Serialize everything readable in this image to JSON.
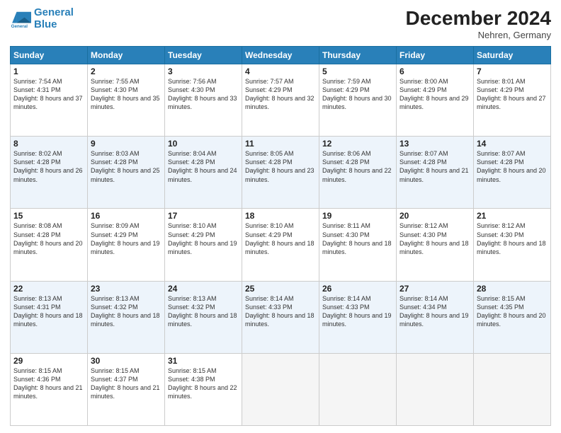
{
  "logo": {
    "line1": "General",
    "line2": "Blue"
  },
  "title": "December 2024",
  "subtitle": "Nehren, Germany",
  "days_header": [
    "Sunday",
    "Monday",
    "Tuesday",
    "Wednesday",
    "Thursday",
    "Friday",
    "Saturday"
  ],
  "weeks": [
    [
      {
        "day": "1",
        "sunrise": "Sunrise: 7:54 AM",
        "sunset": "Sunset: 4:31 PM",
        "daylight": "Daylight: 8 hours and 37 minutes."
      },
      {
        "day": "2",
        "sunrise": "Sunrise: 7:55 AM",
        "sunset": "Sunset: 4:30 PM",
        "daylight": "Daylight: 8 hours and 35 minutes."
      },
      {
        "day": "3",
        "sunrise": "Sunrise: 7:56 AM",
        "sunset": "Sunset: 4:30 PM",
        "daylight": "Daylight: 8 hours and 33 minutes."
      },
      {
        "day": "4",
        "sunrise": "Sunrise: 7:57 AM",
        "sunset": "Sunset: 4:29 PM",
        "daylight": "Daylight: 8 hours and 32 minutes."
      },
      {
        "day": "5",
        "sunrise": "Sunrise: 7:59 AM",
        "sunset": "Sunset: 4:29 PM",
        "daylight": "Daylight: 8 hours and 30 minutes."
      },
      {
        "day": "6",
        "sunrise": "Sunrise: 8:00 AM",
        "sunset": "Sunset: 4:29 PM",
        "daylight": "Daylight: 8 hours and 29 minutes."
      },
      {
        "day": "7",
        "sunrise": "Sunrise: 8:01 AM",
        "sunset": "Sunset: 4:29 PM",
        "daylight": "Daylight: 8 hours and 27 minutes."
      }
    ],
    [
      {
        "day": "8",
        "sunrise": "Sunrise: 8:02 AM",
        "sunset": "Sunset: 4:28 PM",
        "daylight": "Daylight: 8 hours and 26 minutes."
      },
      {
        "day": "9",
        "sunrise": "Sunrise: 8:03 AM",
        "sunset": "Sunset: 4:28 PM",
        "daylight": "Daylight: 8 hours and 25 minutes."
      },
      {
        "day": "10",
        "sunrise": "Sunrise: 8:04 AM",
        "sunset": "Sunset: 4:28 PM",
        "daylight": "Daylight: 8 hours and 24 minutes."
      },
      {
        "day": "11",
        "sunrise": "Sunrise: 8:05 AM",
        "sunset": "Sunset: 4:28 PM",
        "daylight": "Daylight: 8 hours and 23 minutes."
      },
      {
        "day": "12",
        "sunrise": "Sunrise: 8:06 AM",
        "sunset": "Sunset: 4:28 PM",
        "daylight": "Daylight: 8 hours and 22 minutes."
      },
      {
        "day": "13",
        "sunrise": "Sunrise: 8:07 AM",
        "sunset": "Sunset: 4:28 PM",
        "daylight": "Daylight: 8 hours and 21 minutes."
      },
      {
        "day": "14",
        "sunrise": "Sunrise: 8:07 AM",
        "sunset": "Sunset: 4:28 PM",
        "daylight": "Daylight: 8 hours and 20 minutes."
      }
    ],
    [
      {
        "day": "15",
        "sunrise": "Sunrise: 8:08 AM",
        "sunset": "Sunset: 4:28 PM",
        "daylight": "Daylight: 8 hours and 20 minutes."
      },
      {
        "day": "16",
        "sunrise": "Sunrise: 8:09 AM",
        "sunset": "Sunset: 4:29 PM",
        "daylight": "Daylight: 8 hours and 19 minutes."
      },
      {
        "day": "17",
        "sunrise": "Sunrise: 8:10 AM",
        "sunset": "Sunset: 4:29 PM",
        "daylight": "Daylight: 8 hours and 19 minutes."
      },
      {
        "day": "18",
        "sunrise": "Sunrise: 8:10 AM",
        "sunset": "Sunset: 4:29 PM",
        "daylight": "Daylight: 8 hours and 18 minutes."
      },
      {
        "day": "19",
        "sunrise": "Sunrise: 8:11 AM",
        "sunset": "Sunset: 4:30 PM",
        "daylight": "Daylight: 8 hours and 18 minutes."
      },
      {
        "day": "20",
        "sunrise": "Sunrise: 8:12 AM",
        "sunset": "Sunset: 4:30 PM",
        "daylight": "Daylight: 8 hours and 18 minutes."
      },
      {
        "day": "21",
        "sunrise": "Sunrise: 8:12 AM",
        "sunset": "Sunset: 4:30 PM",
        "daylight": "Daylight: 8 hours and 18 minutes."
      }
    ],
    [
      {
        "day": "22",
        "sunrise": "Sunrise: 8:13 AM",
        "sunset": "Sunset: 4:31 PM",
        "daylight": "Daylight: 8 hours and 18 minutes."
      },
      {
        "day": "23",
        "sunrise": "Sunrise: 8:13 AM",
        "sunset": "Sunset: 4:32 PM",
        "daylight": "Daylight: 8 hours and 18 minutes."
      },
      {
        "day": "24",
        "sunrise": "Sunrise: 8:13 AM",
        "sunset": "Sunset: 4:32 PM",
        "daylight": "Daylight: 8 hours and 18 minutes."
      },
      {
        "day": "25",
        "sunrise": "Sunrise: 8:14 AM",
        "sunset": "Sunset: 4:33 PM",
        "daylight": "Daylight: 8 hours and 18 minutes."
      },
      {
        "day": "26",
        "sunrise": "Sunrise: 8:14 AM",
        "sunset": "Sunset: 4:33 PM",
        "daylight": "Daylight: 8 hours and 19 minutes."
      },
      {
        "day": "27",
        "sunrise": "Sunrise: 8:14 AM",
        "sunset": "Sunset: 4:34 PM",
        "daylight": "Daylight: 8 hours and 19 minutes."
      },
      {
        "day": "28",
        "sunrise": "Sunrise: 8:15 AM",
        "sunset": "Sunset: 4:35 PM",
        "daylight": "Daylight: 8 hours and 20 minutes."
      }
    ],
    [
      {
        "day": "29",
        "sunrise": "Sunrise: 8:15 AM",
        "sunset": "Sunset: 4:36 PM",
        "daylight": "Daylight: 8 hours and 21 minutes."
      },
      {
        "day": "30",
        "sunrise": "Sunrise: 8:15 AM",
        "sunset": "Sunset: 4:37 PM",
        "daylight": "Daylight: 8 hours and 21 minutes."
      },
      {
        "day": "31",
        "sunrise": "Sunrise: 8:15 AM",
        "sunset": "Sunset: 4:38 PM",
        "daylight": "Daylight: 8 hours and 22 minutes."
      },
      null,
      null,
      null,
      null
    ]
  ]
}
